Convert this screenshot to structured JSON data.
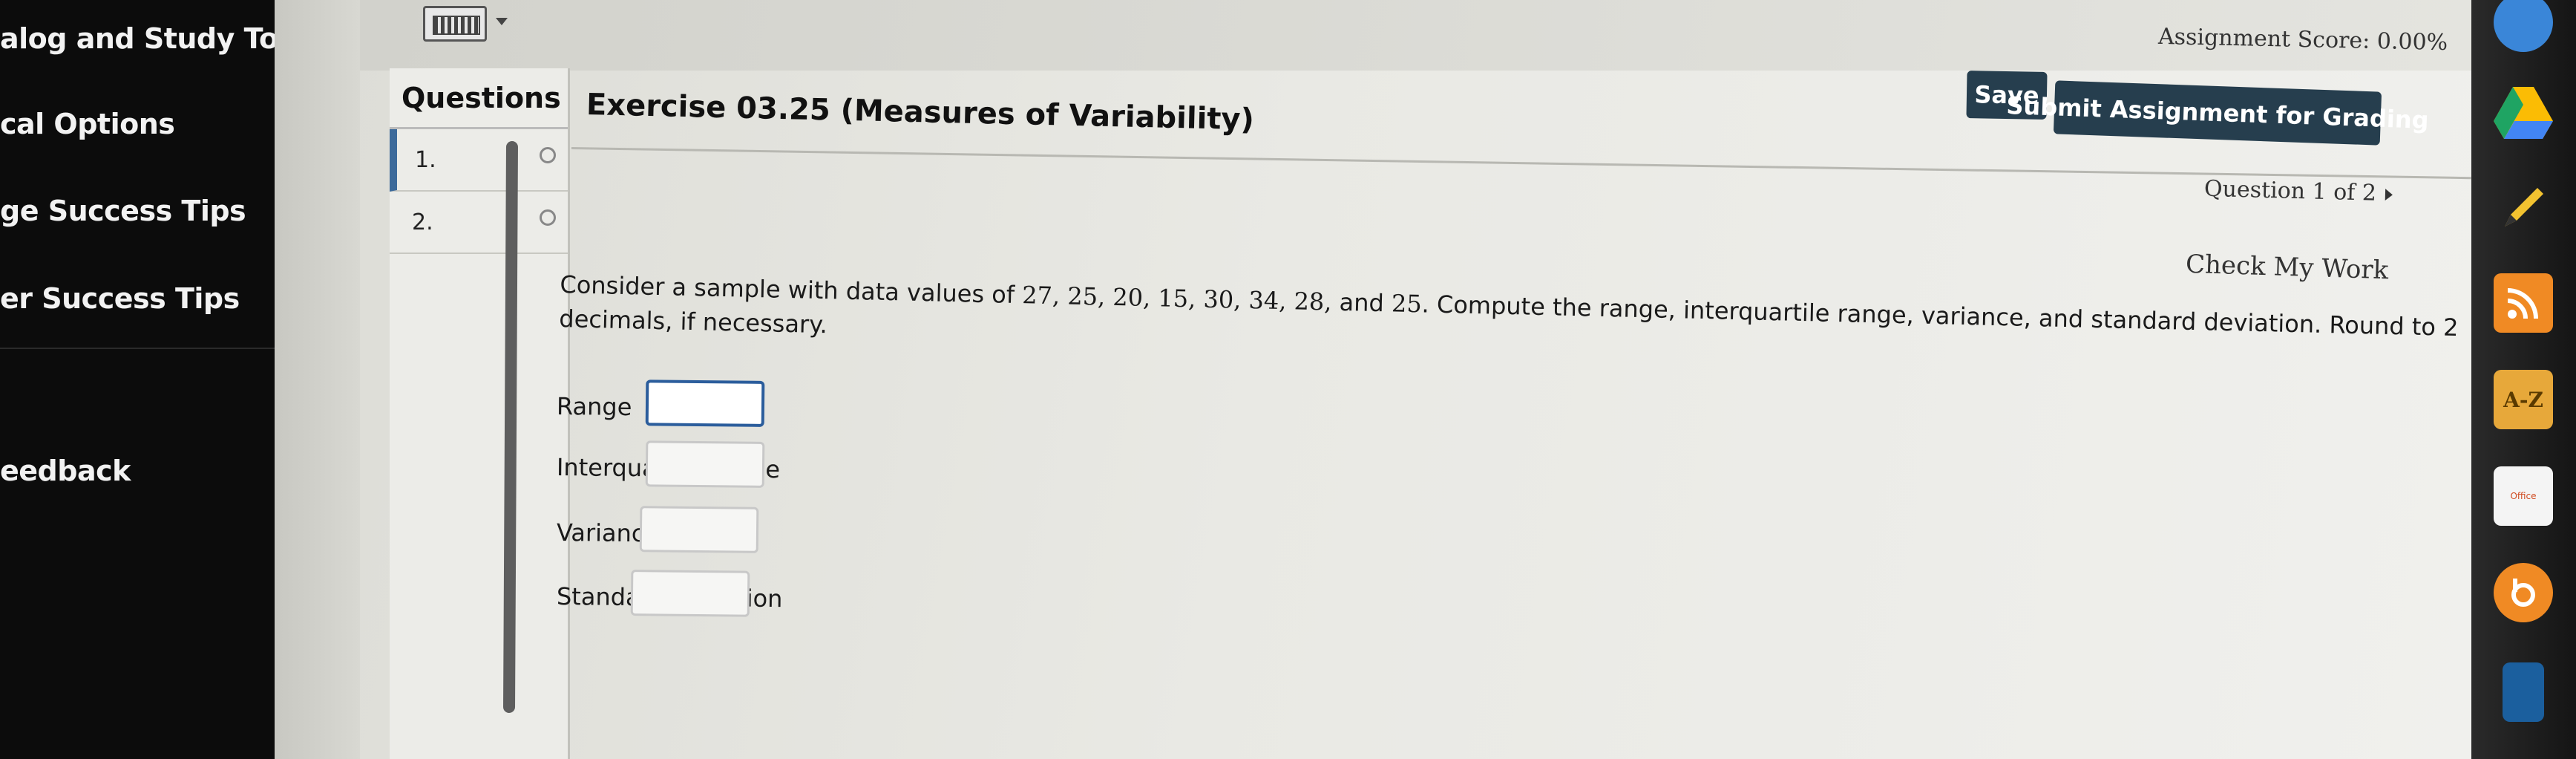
{
  "sidebar": {
    "items": [
      {
        "label": "alog and Study Tools"
      },
      {
        "label": "cal Options"
      },
      {
        "label": "ge Success Tips"
      },
      {
        "label": "er Success Tips"
      },
      {
        "label": "eedback"
      }
    ]
  },
  "header": {
    "assignment_score": "Assignment Score: 0.00%",
    "save_label": "Save",
    "submit_label": "Submit Assignment for Grading"
  },
  "questions_panel": {
    "title": "Questions",
    "items": [
      {
        "number": "1."
      },
      {
        "number": "2."
      }
    ]
  },
  "exercise": {
    "title": "Exercise 03.25 (Measures of Variability)",
    "counter": "Question 1 of 2",
    "check_work": "Check My Work",
    "problem_prefix": "Consider a sample with data values of ",
    "data_values": "27, 25, 20, 15, 30, 34, 28,",
    "problem_and": " and ",
    "last_value": "25",
    "problem_suffix": ". Compute the range, interquartile range, variance, and standard deviation. Round to 2 decimals, if necessary.",
    "fields": [
      {
        "label": "Range",
        "value": ""
      },
      {
        "label": "Interquartile range",
        "value": ""
      },
      {
        "label": "Variance",
        "value": ""
      },
      {
        "label": "Standard deviation",
        "value": ""
      }
    ]
  },
  "dock": {
    "icons": [
      "cloud-icon",
      "google-drive-icon",
      "pencil-icon",
      "rss-icon",
      "a-z-icon",
      "office-icon",
      "orange-app-icon",
      "book-icon"
    ],
    "az_label": "A-Z",
    "office_label": "Office"
  },
  "colors": {
    "button_bg": "#263e4e",
    "active_row_accent": "#3c6a9a",
    "input_focus": "#2b5d9c",
    "rss_orange": "#f08a24"
  }
}
